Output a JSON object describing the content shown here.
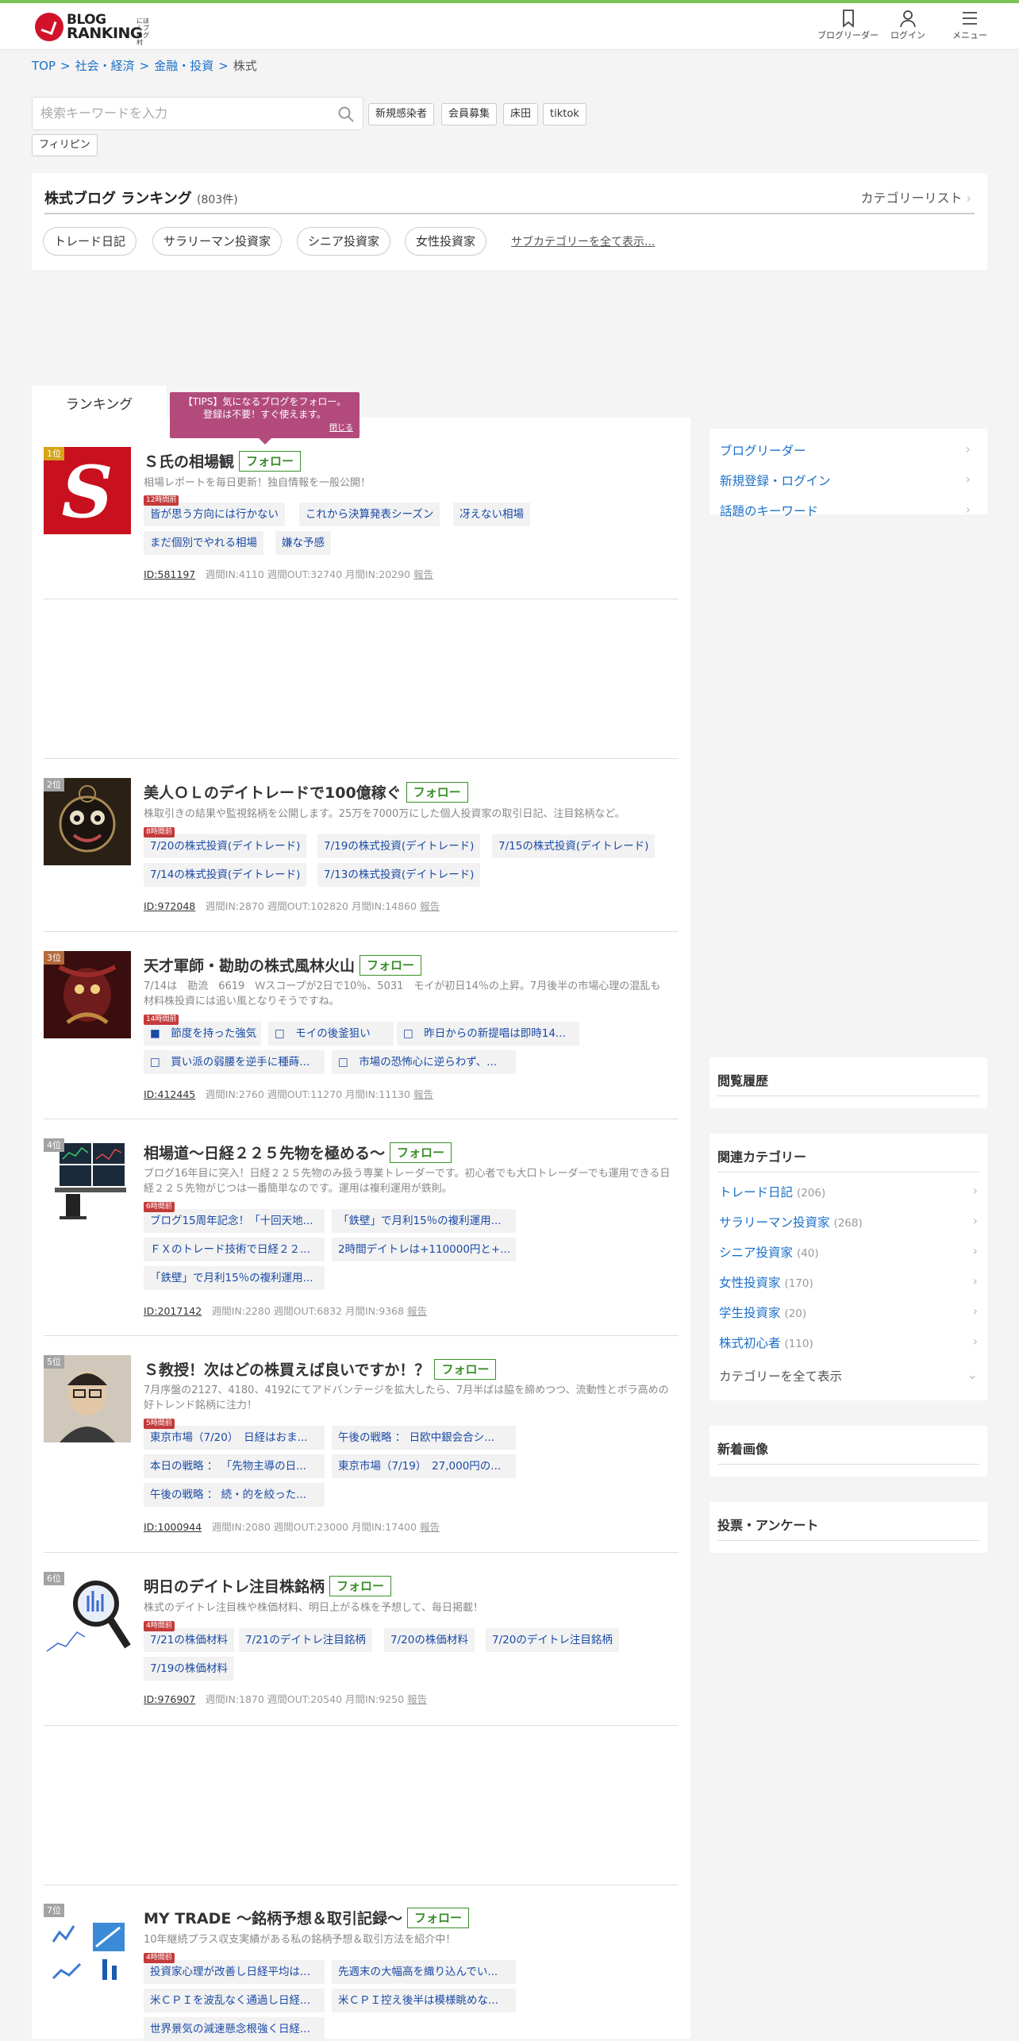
{
  "header": {
    "logo_line1": "BLOG",
    "logo_line2": "RANKING",
    "logo_sub": "にほんブログ村",
    "nav": [
      {
        "label": "ブログリーダー",
        "icon": "bookmark-icon"
      },
      {
        "label": "ログイン",
        "icon": "user-icon"
      },
      {
        "label": "メニュー",
        "icon": "menu-icon"
      }
    ]
  },
  "breadcrumb": [
    "TOP",
    "社会・経済",
    "金融・投資",
    "株式"
  ],
  "search": {
    "placeholder": "検索キーワードを入力",
    "keywords": [
      "新規感染者",
      "会員募集",
      "床田",
      "tiktok",
      "フィリピン"
    ]
  },
  "category": {
    "title": "株式ブログ ランキング",
    "count": "(803件)",
    "list_link": "カテゴリーリスト",
    "subcats": [
      "トレード日記",
      "サラリーマン投資家",
      "シニア投資家",
      "女性投資家"
    ],
    "subcats_all": "サブカテゴリーを全て表示..."
  },
  "ranking_tab": "ランキング",
  "tips": {
    "line1": "【TIPS】気になるブログをフォロー。",
    "line2": "登録は不要！すぐ使えます。",
    "close": "閉じる"
  },
  "follow_label": "フォロー",
  "entries": [
    {
      "rank": "1位",
      "title": "Ｓ氏の相場観",
      "desc": "相場レポートを毎日更新！独自情報を一般公開！",
      "hours": "12時間前",
      "articles": [
        "皆が思う方向には行かない",
        "これから決算発表シーズン",
        "冴えない相場",
        "まだ個別でやれる相場",
        "嫌な予感"
      ],
      "id": "ID:581197",
      "stats": "週間IN:4110 週間OUT:32740 月間IN:20290",
      "report": "報告"
    },
    {
      "rank": "2位",
      "title": "美人ＯＬのデイトレードで100億稼ぐ",
      "desc": "株取引きの結果や監視銘柄を公開します。25万を7000万にした個人投資家の取引日記、注目銘柄など。",
      "hours": "8時間前",
      "articles": [
        "7/20の株式投資(デイトレード)",
        "7/19の株式投資(デイトレード)",
        "7/15の株式投資(デイトレード)",
        "7/14の株式投資(デイトレード)",
        "7/13の株式投資(デイトレード)"
      ],
      "id": "ID:972048",
      "stats": "週間IN:2870 週間OUT:102820 月間IN:14860",
      "report": "報告"
    },
    {
      "rank": "3位",
      "title": "天才軍師・勘助の株式風林火山",
      "desc": "7/14は　勘流　6619　Ｗスコープが2日で10％、5031　モイが初日14％の上昇。7月後半の市場心理の混乱も　材料株投資には追い風となりそうですね。",
      "hours": "14時間前",
      "articles": [
        "■　節度を持った強気",
        "□　モイの後釜狙い",
        "□　昨日からの新提唱は即時14...",
        "□　買い派の弱腰を逆手に種蒔...",
        "□　市場の恐怖心に逆らわず、..."
      ],
      "id": "ID:412445",
      "stats": "週間IN:2760 週間OUT:11270 月間IN:11130",
      "report": "報告"
    },
    {
      "rank": "4位",
      "title": "相場道〜日経２２５先物を極める〜",
      "desc": "ブログ16年目に突入！日経２２５先物のみ扱う専業トレーダーです。初心者でも大口トレーダーでも運用できる日経２２５先物がじつは一番簡単なのです。運用は複利運用が鉄則。",
      "hours": "6時間前",
      "articles": [
        "ブログ15周年記念！「十回天地...",
        "「鉄壁」で月利15％の複利運用...",
        "ＦＸのトレード技術で日経２２...",
        "2時間デイトレは+110000円と+...",
        "「鉄壁」で月利15％の複利運用..."
      ],
      "id": "ID:2017142",
      "stats": "週間IN:2280 週間OUT:6832 月間IN:9368",
      "report": "報告"
    },
    {
      "rank": "5位",
      "title": "Ｓ教授！次はどの株買えば良いですか！？",
      "desc": "7月序盤の2127、4180、4192にてアドバンテージを拡大したら、7月半ばは脇を締めつつ、流動性とボラ高めの好トレンド銘柄に注力！",
      "hours": "5時間前",
      "articles": [
        "東京市場（7/20）　日経はおま...",
        "午後の戦略 ： 日欧中銀会合シ...",
        "本日の戦略 ： 「先物主導の日...",
        "東京市場（7/19）　27,000円の...",
        "午後の戦略 ： 続・的を絞った..."
      ],
      "id": "ID:1000944",
      "stats": "週間IN:2080 週間OUT:23000 月間IN:17400",
      "report": "報告"
    },
    {
      "rank": "6位",
      "title": "明日のデイトレ注目株銘柄",
      "desc": "株式のデイトレ注目株や株価材料、明日上がる株を予想して、毎日掲載！",
      "hours": "4時間前",
      "articles": [
        "7/21の株価材料",
        "7/21のデイトレ注目銘柄",
        "7/20の株価材料",
        "7/20のデイトレ注目銘柄",
        "7/19の株価材料"
      ],
      "id": "ID:976907",
      "stats": "週間IN:1870 週間OUT:20540 月間IN:9250",
      "report": "報告"
    },
    {
      "rank": "7位",
      "title": "MY TRADE 〜銘柄予想＆取引記録〜",
      "desc": "10年継続プラス収支実績がある私の銘柄予想＆取引方法を紹介中！",
      "hours": "4時間前",
      "articles": [
        "投資家心理が改善し日経平均は...",
        "先週末の大幅高を織り込んでい...",
        "米ＣＰＩを波乱なく通過し日経...",
        "米ＣＰＩ控え後半は模様眺めな...",
        "世界景気の減速懸念根強く日経..."
      ]
    }
  ],
  "sidebar": {
    "links": [
      "ブログリーダー",
      "新規登録・ログイン",
      "話題のキーワード"
    ],
    "history_title": "閲覧履歴",
    "related_title": "関連カテゴリー",
    "related": [
      {
        "name": "トレード日記",
        "count": "(206)"
      },
      {
        "name": "サラリーマン投資家",
        "count": "(268)"
      },
      {
        "name": "シニア投資家",
        "count": "(40)"
      },
      {
        "name": "女性投資家",
        "count": "(170)"
      },
      {
        "name": "学生投資家",
        "count": "(20)"
      },
      {
        "name": "株式初心者",
        "count": "(110)"
      }
    ],
    "related_all": "カテゴリーを全て表示",
    "new_images_title": "新着画像",
    "vote_title": "投票・アンケート"
  },
  "colors": {
    "accent_green": "#7cc45a",
    "link_blue": "#1a6fc9",
    "follow_green": "#3a8f2a",
    "tips_bg": "#b24b7c",
    "logo_red": "#d2122b"
  }
}
